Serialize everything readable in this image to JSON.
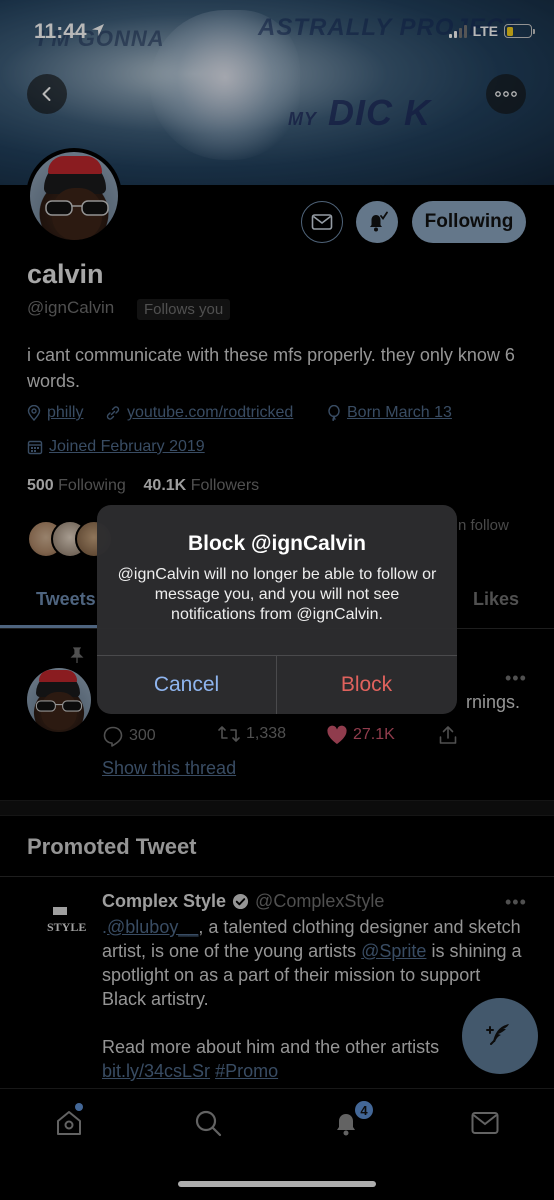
{
  "status_bar": {
    "time": "11:44",
    "network": "LTE"
  },
  "banner": {
    "text_1": "I'M GONNA",
    "text_2": "ASTRALLY PROJECT",
    "text_3_small": "MY",
    "text_3_big": "DIC K"
  },
  "profile": {
    "name": "calvin",
    "handle": "@ignCalvin",
    "follows_you": "Follows you",
    "following_button": "Following",
    "bio": "i cant communicate with these mfs properly. they only know 6 words.",
    "location": "philly",
    "link": "youtube.com/rodtricked",
    "birthday": "Born March 13",
    "joined": "Joined February 2019",
    "following_count": "500",
    "following_label": "Following",
    "followers_count": "40.1K",
    "followers_label": "Followers",
    "followers_you_know_tail": "n follow"
  },
  "tabs": {
    "tweets": "Tweets",
    "likes": "Likes"
  },
  "pinned_tweet": {
    "text_tail": "rnings.",
    "more": "•••",
    "replies": "300",
    "retweets": "1,338",
    "likes": "27.1K",
    "show_thread": "Show this thread"
  },
  "promoted": {
    "heading": "Promoted Tweet",
    "logo_text": "STYLE",
    "name": "Complex Style",
    "handle": "@ComplexStyle",
    "more": "•••",
    "body_prefix": ".",
    "mention_1": "@bluboy__",
    "body_1": ", a talented clothing designer and sketch artist, is one of the young artists ",
    "mention_2": "@Sprite",
    "body_2": " is shining a spotlight on as a part of their mission to support Black artistry.",
    "body_3": "Read more about him and the other artists",
    "link": "bit.ly/34csLSr",
    "hashtag": "#Promo"
  },
  "dialog": {
    "title": "Block @ignCalvin",
    "message": "@ignCalvin will no longer be able to follow or message you, and you will not see notifications from @ignCalvin.",
    "cancel": "Cancel",
    "block": "Block"
  },
  "bottom_nav": {
    "notifications_badge": "4"
  },
  "colors": {
    "accent": "#8ba6c0",
    "link": "#4f6a8a",
    "like": "#c8546b",
    "destructive": "#e0625d",
    "dialog_cancel": "#8fb5ef"
  }
}
